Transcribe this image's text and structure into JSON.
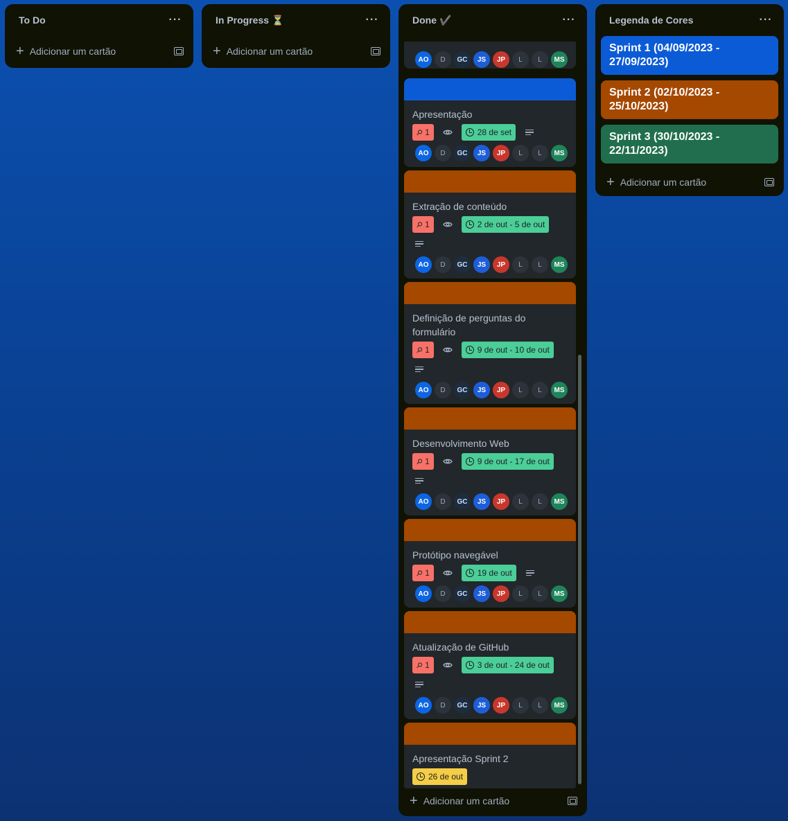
{
  "colors": {
    "sprint1": "#0c5bd6",
    "sprint2": "#a54800",
    "sprint3": "#216e4e"
  },
  "lists": {
    "todo": {
      "title": "To Do",
      "add_label": "Adicionar um cartão"
    },
    "inprogress": {
      "title": "In Progress",
      "emoji": "⏳",
      "add_label": "Adicionar um cartão"
    },
    "done": {
      "title": "Done",
      "emoji": "✔️",
      "add_label": "Adicionar um cartão"
    },
    "legend": {
      "title": "Legenda de Cores",
      "add_label": "Adicionar um cartão",
      "items": [
        {
          "label": "Sprint 1 (04/09/2023 - 27/09/2023)",
          "color": "sprint1"
        },
        {
          "label": "Sprint 2 (02/10/2023 - 25/10/2023)",
          "color": "sprint2"
        },
        {
          "label": "Sprint 3 (30/10/2023 - 22/11/2023)",
          "color": "sprint3"
        }
      ]
    }
  },
  "members": [
    "AO",
    "D",
    "GC",
    "JS",
    "JP",
    "L",
    "L",
    "MS"
  ],
  "cards": [
    {
      "title": "Apresentação",
      "pins": "1",
      "date": "28 de set",
      "cover": "sprint1"
    },
    {
      "title": "Extração de conteúdo",
      "pins": "1",
      "date": "2 de out - 5 de out",
      "cover": "sprint2"
    },
    {
      "title": "Definição de perguntas do formulário",
      "pins": "1",
      "date": "9 de out - 10 de out",
      "cover": "sprint2"
    },
    {
      "title": "Desenvolvimento Web",
      "pins": "1",
      "date": "9 de out - 17 de out",
      "cover": "sprint2"
    },
    {
      "title": "Protótipo navegável",
      "pins": "1",
      "date": "19 de out",
      "cover": "sprint2"
    },
    {
      "title": "Atualização de GitHub",
      "pins": "1",
      "date": "3 de out - 24 de out",
      "cover": "sprint2"
    },
    {
      "title": "Apresentação Sprint 2",
      "date": "26 de out",
      "cover": "sprint2"
    }
  ]
}
